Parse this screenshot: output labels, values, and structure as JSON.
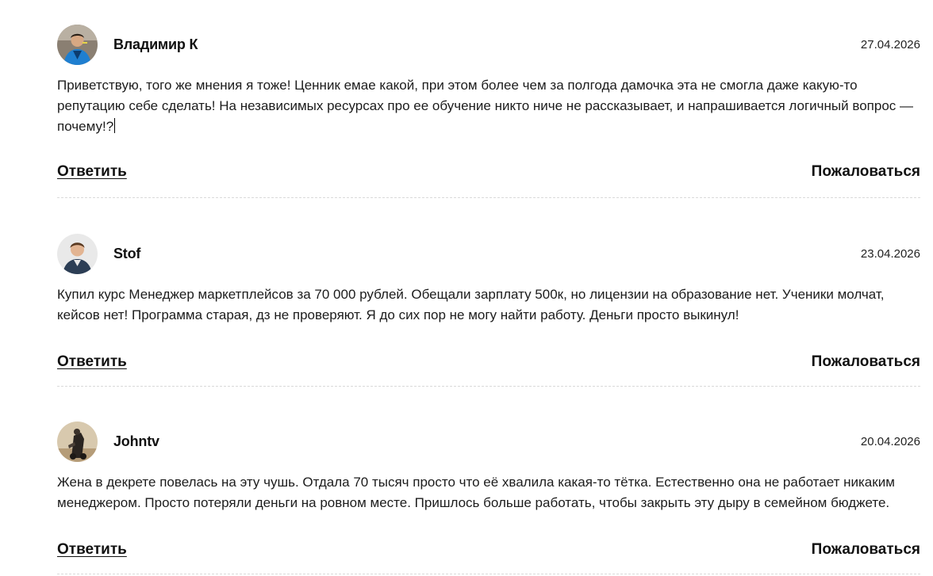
{
  "comments": [
    {
      "author": "Владимир К",
      "date": "27.04.2026",
      "text": "Приветствую, того же мнения я тоже! Ценник емае какой, при этом более чем за полгода дамочка эта не смогла даже какую-то репутацию себе сделать! На независимых ресурсах про ее обучение никто ниче не рассказывает, и напрашивается логичный вопрос — почему!?",
      "reply_label": "Ответить",
      "report_label": "Пожаловаться"
    },
    {
      "author": "Stof",
      "date": "23.04.2026",
      "text": "Купил курс Менеджер маркетплейсов за 70 000 рублей. Обещали зарплату 500к, но лицензии на образование нет. Ученики молчат, кейсов нет! Программа старая, дз не проверяют. Я до сих пор не могу найти работу. Деньги просто выкинул!",
      "reply_label": "Ответить",
      "report_label": "Пожаловаться"
    },
    {
      "author": "Johntv",
      "date": "20.04.2026",
      "text": "Жена в декрете повелась на эту чушь. Отдала 70 тысяч просто что её хвалила какая-то тётка. Естественно она не работает никаким менеджером. Просто потеряли деньги на ровном месте. Пришлось больше работать, чтобы закрыть эту дыру в семейном бюджете.",
      "reply_label": "Ответить",
      "report_label": "Пожаловаться"
    }
  ]
}
